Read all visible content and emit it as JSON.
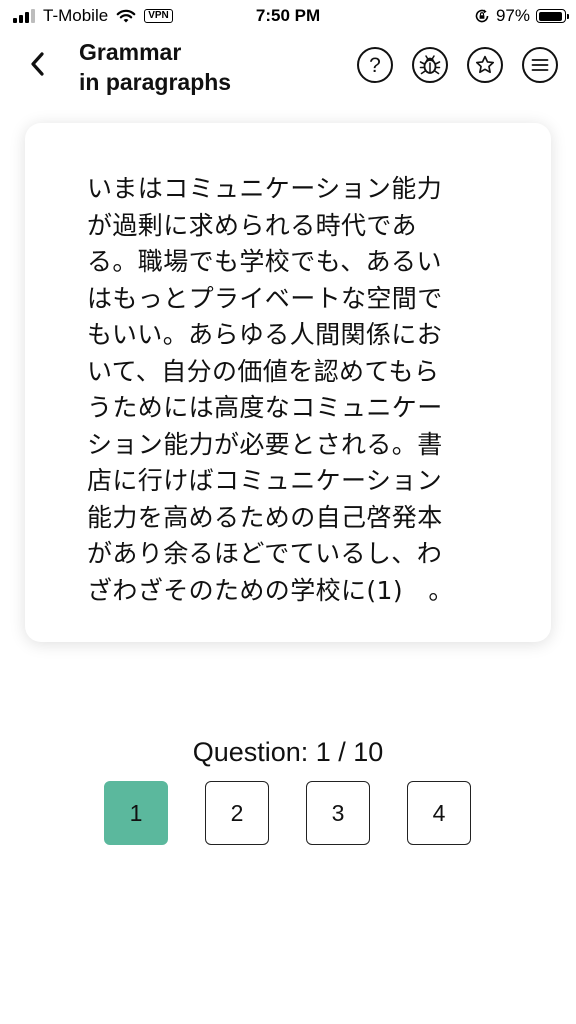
{
  "status_bar": {
    "carrier": "T-Mobile",
    "vpn": "VPN",
    "time": "7:50 PM",
    "battery_percent": "97%",
    "battery_level": 0.97
  },
  "header": {
    "title_line1": "Grammar",
    "title_line2": "in paragraphs",
    "help_symbol": "?",
    "icons": [
      "back-chevron-icon",
      "help-icon",
      "bug-icon",
      "star-icon",
      "menu-icon"
    ]
  },
  "passage": {
    "lines": [
      "いまはコミュニケーション能力",
      "が過剰に求められる時代であ",
      "る。職場でも学校でも、あるい",
      "はもっとプライベートな空間で",
      "もいい。あらゆる人間関係にお",
      "いて、自分の価値を認めてもら",
      "うためには高度なコミュニケー",
      "ション能力が必要とされる。書",
      "店に行けばコミュニケーション",
      "能力を高めるための自己啓発本",
      "があり余るほどでているし、わ",
      "ざわざそのための学校に(1)　。"
    ]
  },
  "question": {
    "label": "Question: 1 / 10",
    "options": [
      "1",
      "2",
      "3",
      "4"
    ],
    "selected": "1",
    "accent_color": "#5bb89d"
  }
}
